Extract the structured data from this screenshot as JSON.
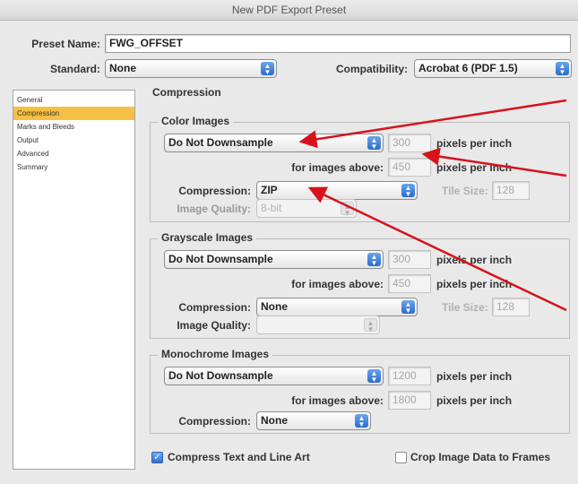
{
  "window": {
    "title": "New PDF Export Preset"
  },
  "preset": {
    "label": "Preset Name:",
    "value": "FWG_OFFSET"
  },
  "standard": {
    "label": "Standard:",
    "value": "None"
  },
  "compatibility": {
    "label": "Compatibility:",
    "value": "Acrobat 6 (PDF 1.5)"
  },
  "sidebar": {
    "items": [
      {
        "label": "General"
      },
      {
        "label": "Compression",
        "selected": true
      },
      {
        "label": "Marks and Bleeds"
      },
      {
        "label": "Output"
      },
      {
        "label": "Advanced"
      },
      {
        "label": "Summary"
      }
    ]
  },
  "section_title": "Compression",
  "color": {
    "title": "Color Images",
    "downsample": "Do Not Downsample",
    "ppi": "300",
    "ppi_unit": "pixels per inch",
    "above_label": "for images above:",
    "above": "450",
    "above_unit": "pixels per inch",
    "compression_label": "Compression:",
    "compression": "ZIP",
    "tile_label": "Tile Size:",
    "tile": "128",
    "quality_label": "Image Quality:",
    "quality": "8-bit"
  },
  "grayscale": {
    "title": "Grayscale Images",
    "downsample": "Do Not Downsample",
    "ppi": "300",
    "ppi_unit": "pixels per inch",
    "above_label": "for images above:",
    "above": "450",
    "above_unit": "pixels per inch",
    "compression_label": "Compression:",
    "compression": "None",
    "tile_label": "Tile Size:",
    "tile": "128",
    "quality_label": "Image Quality:",
    "quality": ""
  },
  "monochrome": {
    "title": "Monochrome Images",
    "downsample": "Do Not Downsample",
    "ppi": "1200",
    "ppi_unit": "pixels per inch",
    "above_label": "for images above:",
    "above": "1800",
    "above_unit": "pixels per inch",
    "compression_label": "Compression:",
    "compression": "None"
  },
  "options": {
    "compress_text": {
      "label": "Compress Text and Line Art",
      "checked": true
    },
    "crop_image": {
      "label": "Crop Image Data to Frames",
      "checked": false
    }
  },
  "colors": {
    "arrow": "#d8121b",
    "selection": "#f5c043",
    "stepper": "#2a6bd0"
  },
  "icons": {
    "stepper": "up-down-arrows-icon",
    "checkmark": "check-icon"
  }
}
